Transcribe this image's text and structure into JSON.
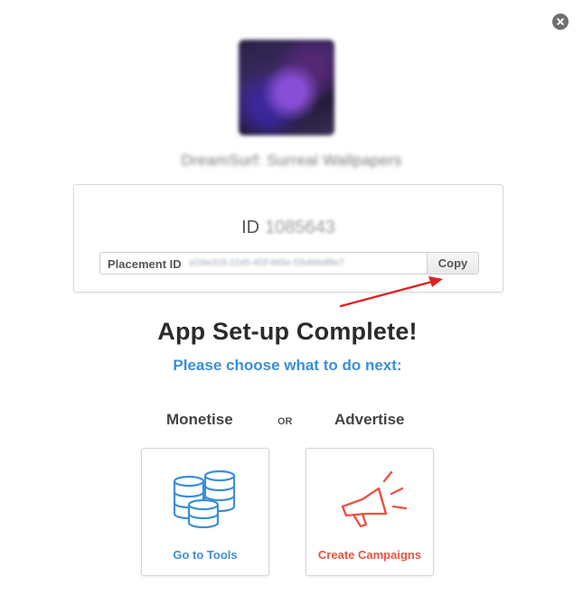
{
  "dialog": {
    "close_icon": "close-icon"
  },
  "app": {
    "icon": "app-icon-image",
    "name": "DreamSurf: Surreal Wallpapers"
  },
  "id_panel": {
    "id_label": "ID",
    "id_value": "1085643",
    "placement_label": "Placement ID",
    "placement_value": "a1f4e318-2245-4f2f-865e-f2b466df8e7",
    "copy_label": "Copy"
  },
  "setup": {
    "title": "App Set-up Complete!",
    "subtitle": "Please choose what to do next:"
  },
  "choices": {
    "monetise_heading": "Monetise",
    "or_label": "OR",
    "advertise_heading": "Advertise",
    "tools_label": "Go to Tools",
    "tools_icon": "coins-stack-icon",
    "campaigns_label": "Create Campaigns",
    "campaigns_icon": "megaphone-icon"
  },
  "colors": {
    "accent_blue": "#3b8fd6",
    "accent_red": "#e8543f",
    "arrow_red": "#e02020"
  }
}
